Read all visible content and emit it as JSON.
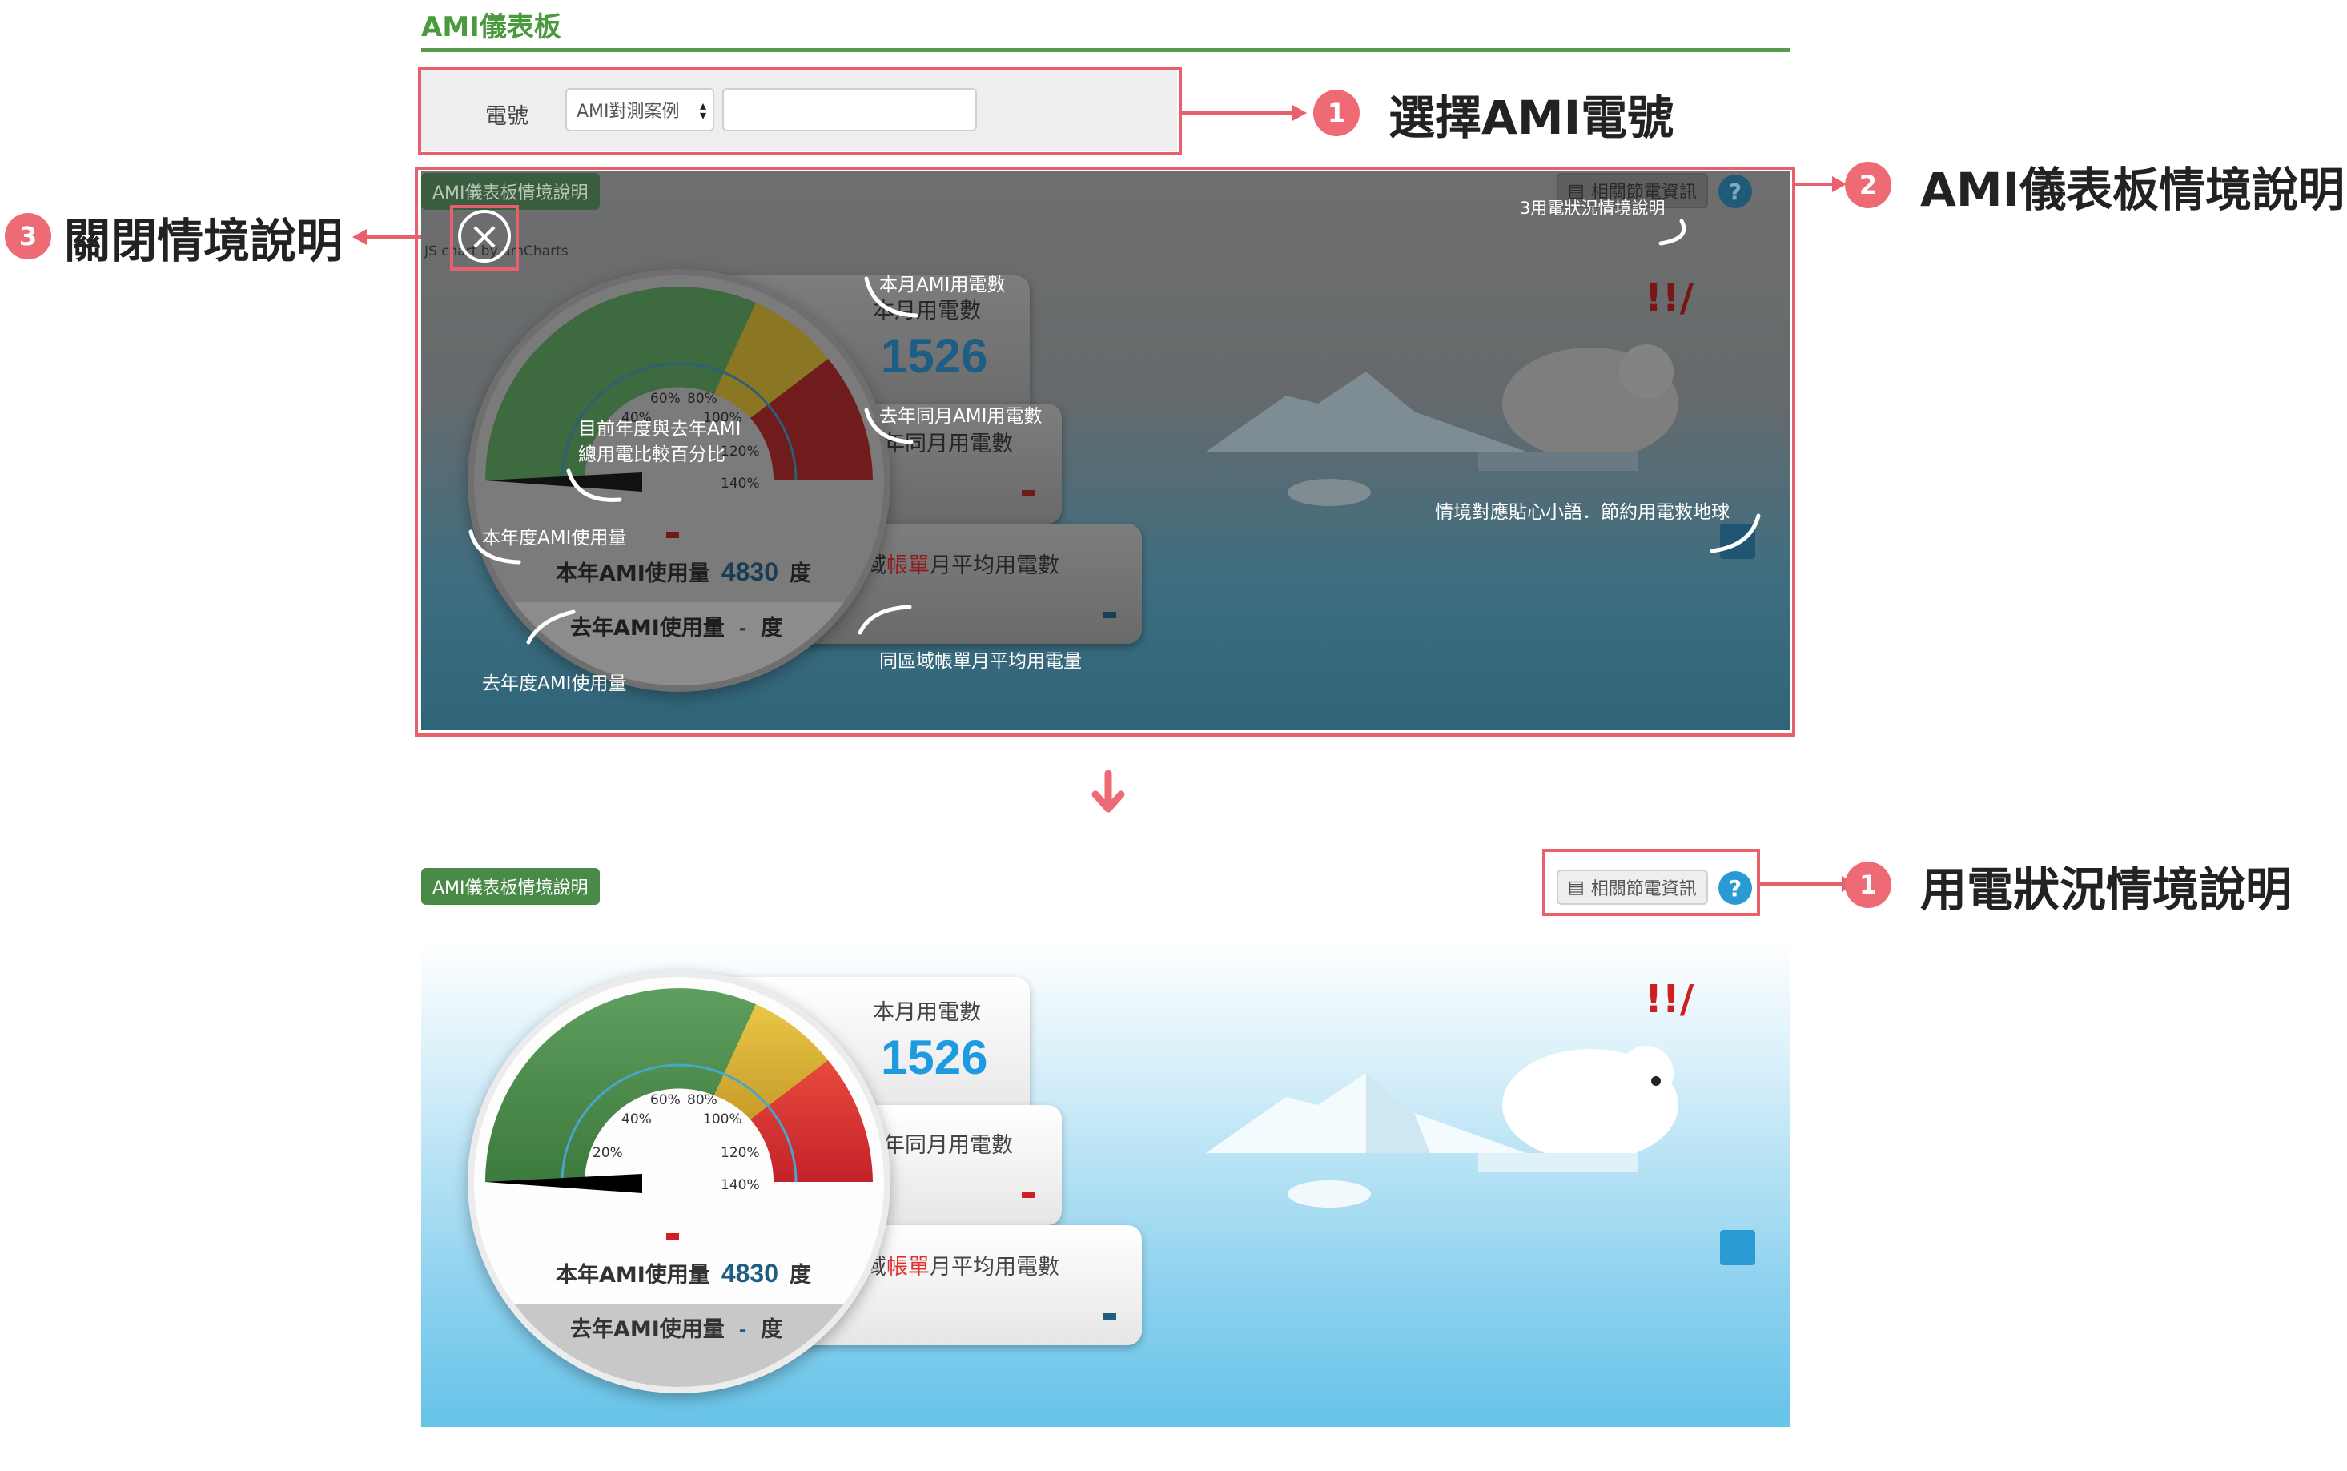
{
  "header": {
    "title": "AMI儀表板"
  },
  "selector": {
    "label": "電號",
    "case_option": "AMI對測案例",
    "input_value": ""
  },
  "callouts": {
    "select": {
      "num": "1",
      "text": "選擇AMI電號"
    },
    "panel": {
      "num": "2",
      "text": "AMI儀表板情境說明"
    },
    "close": {
      "num": "3",
      "text": "關閉情境說明"
    },
    "status": {
      "num": "1",
      "text": "用電狀況情境說明"
    }
  },
  "dashboard": {
    "scenario_button": "AMI儀表板情境說明",
    "chart_credit": "JS chart by amCharts",
    "related_info_button": "相關節電資訊",
    "help_icon": "?",
    "this_month_label": "本月用電數",
    "this_month_value": "1526",
    "last_year_month_label": "去年同月用電數",
    "last_year_month_value": "-",
    "area_avg_prefix": "同區域",
    "area_avg_red": "帳單",
    "area_avg_suffix": "月平均用電數",
    "area_avg_value": "-",
    "this_year_label": "本年AMI使用量",
    "this_year_value": "4830",
    "unit": "度",
    "last_year_label": "去年AMI使用量",
    "last_year_value": "-",
    "gauge_ticks": [
      "20%",
      "40%",
      "60%",
      "80%",
      "100%",
      "120%",
      "140%"
    ],
    "exclaim": "!!/"
  },
  "annotations": {
    "status_note": "3用電狀況情境說明",
    "this_month_ami": "本月AMI用電數",
    "last_year_month_ami": "去年同月AMI用電數",
    "gauge_note_line1": "目前年度與去年AMI",
    "gauge_note_line2": "總用電比較百分比",
    "this_year_ami": "本年度AMI使用量",
    "last_year_ami": "去年度AMI使用量",
    "area_avg_note": "同區域帳單月平均用電量",
    "tips_note": "情境對應貼心小語．節約用電救地球"
  },
  "colors": {
    "accent_green": "#4a9a3e",
    "highlight_red": "#e8606c",
    "number_blue": "#1d9ae0",
    "sky_blue": "#66c3e8"
  }
}
